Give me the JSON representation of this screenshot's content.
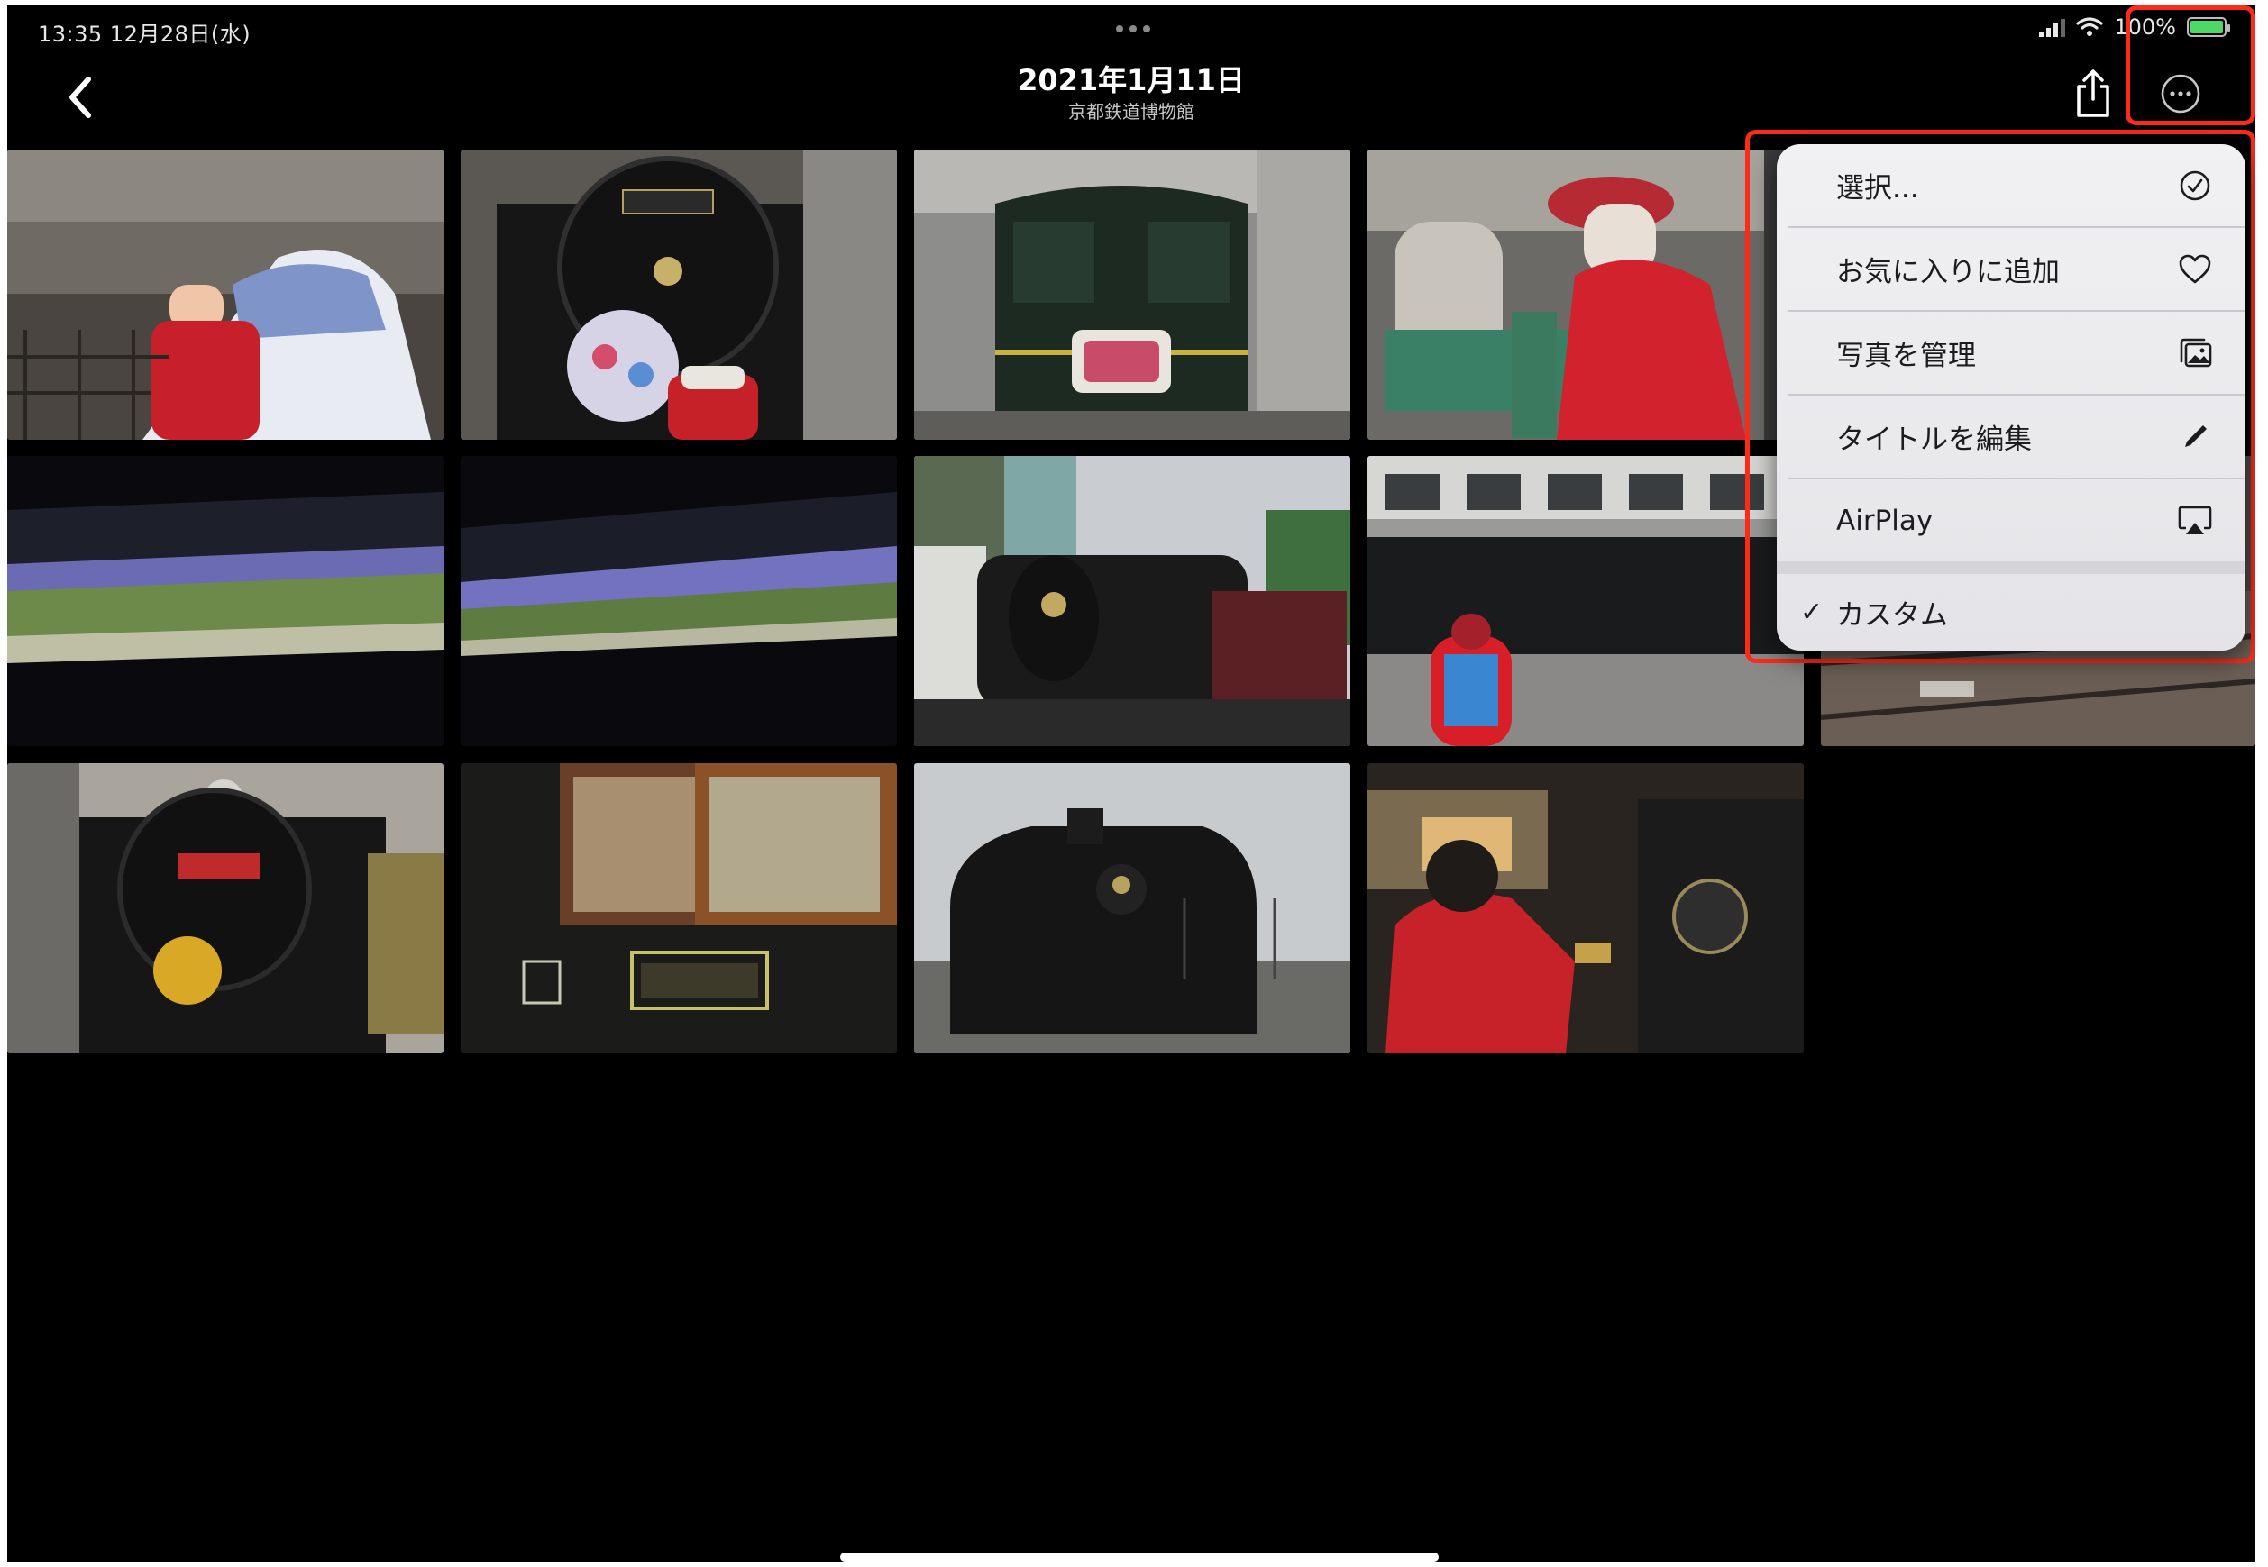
{
  "status_bar": {
    "time": "13:35  12月28日(水)",
    "battery_text": "100%",
    "battery_level": 1.0
  },
  "nav": {
    "title": "2021年1月11日",
    "subtitle": "京都鉄道博物館"
  },
  "menu": {
    "items": [
      {
        "label": "選択...",
        "icon": "checkmark-circle-icon"
      },
      {
        "label": "お気に入りに追加",
        "icon": "heart-icon"
      },
      {
        "label": "写真を管理",
        "icon": "photos-stack-icon"
      },
      {
        "label": "タイトルを編集",
        "icon": "pencil-icon"
      },
      {
        "label": "AirPlay",
        "icon": "airplay-icon"
      }
    ],
    "selected_option": {
      "label": "カスタム",
      "checked": true
    }
  },
  "photos": [
    {
      "name": "shinkansen-with-child"
    },
    {
      "name": "steam-locomotive-c62-front"
    },
    {
      "name": "twilight-express-rear"
    },
    {
      "name": "child-with-green-machine"
    },
    {
      "name": "museum-ceiling-panorama-1"
    },
    {
      "name": "museum-ceiling-panorama-2"
    },
    {
      "name": "steam-locomotive-outdoor-palms"
    },
    {
      "name": "roundhouse-locomotives-child"
    },
    {
      "name": "roundhouse-tracks"
    },
    {
      "name": "locomotive-c51239-chrysanthemum"
    },
    {
      "name": "train-window-mugen-sign"
    },
    {
      "name": "steam-locomotive-cloudy-sky"
    },
    {
      "name": "child-in-cab-controls"
    }
  ],
  "colors": {
    "highlight": "#ff2a1a",
    "background": "#000000",
    "menu_bg": "#eeeef1"
  }
}
